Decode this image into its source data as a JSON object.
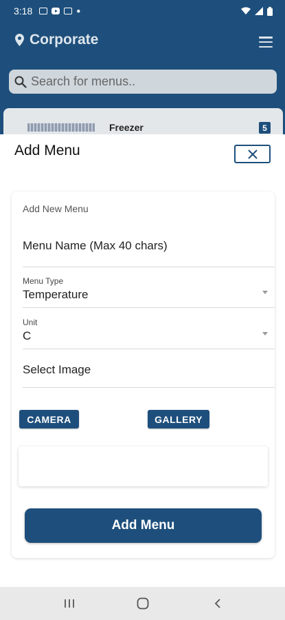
{
  "status_bar": {
    "time": "3:18",
    "notification_icons": [
      "image-icon",
      "youtube-icon",
      "image-icon",
      "dot"
    ],
    "system_icons": [
      "wifi-icon",
      "signal-icon",
      "battery-icon"
    ]
  },
  "header": {
    "location_icon": "location-pin-icon",
    "title": "Corporate",
    "menu_icon": "hamburger-icon"
  },
  "search": {
    "icon": "search-icon",
    "placeholder": "Search for menus.."
  },
  "list_peek": {
    "name": "Freezer",
    "count": "5"
  },
  "sheet": {
    "title": "Add Menu",
    "close_icon": "close-icon"
  },
  "form": {
    "heading": "Add New Menu",
    "menu_name_placeholder": "Menu Name (Max 40 chars)",
    "menu_type": {
      "label": "Menu Type",
      "value": "Temperature"
    },
    "unit": {
      "label": "Unit",
      "value": "C"
    },
    "select_image_label": "Select Image",
    "camera_label": "CAMERA",
    "gallery_label": "GALLERY",
    "submit_label": "Add Menu"
  },
  "nav_bar": {
    "recent_icon": "recent-apps-icon",
    "home_icon": "home-icon",
    "back_icon": "back-icon"
  },
  "colors": {
    "primary": "#1e4f7c",
    "search_bg": "#cfd6dc",
    "nav_bg": "#e9e9e9"
  }
}
